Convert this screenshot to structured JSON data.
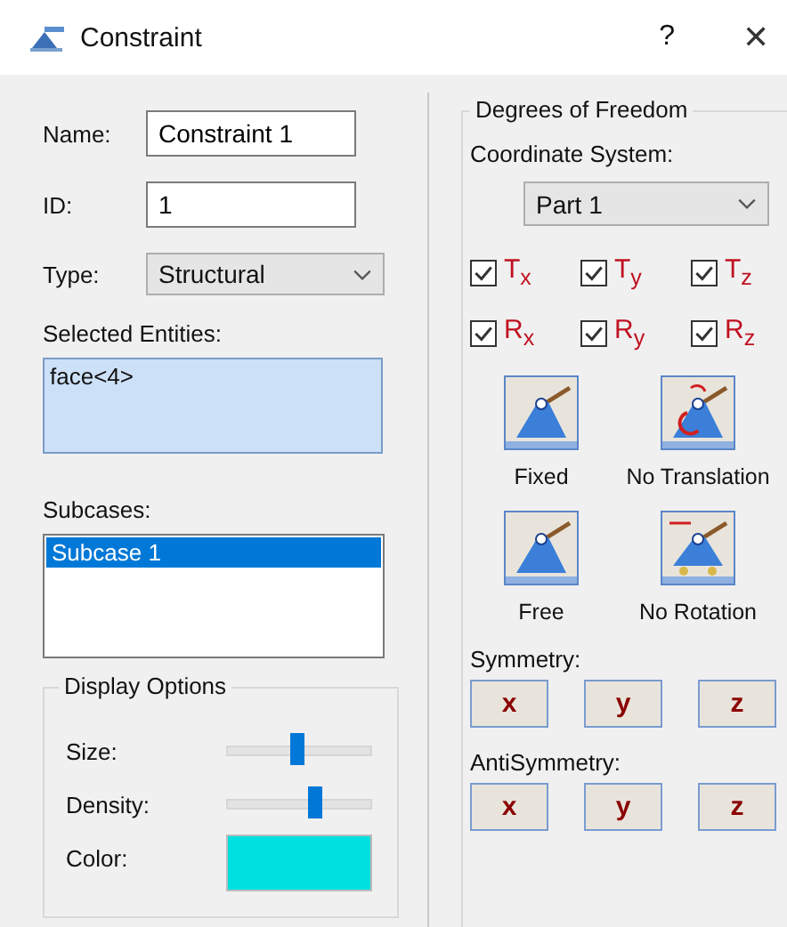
{
  "window": {
    "title": "Constraint",
    "help": "?",
    "close": "✕"
  },
  "name": {
    "label": "Name:",
    "value": "Constraint 1"
  },
  "id": {
    "label": "ID:",
    "value": "1"
  },
  "type": {
    "label": "Type:",
    "value": "Structural"
  },
  "selected_entities": {
    "label": "Selected Entities:",
    "items": [
      "face<4>"
    ]
  },
  "subcases": {
    "label": "Subcases:",
    "items": [
      {
        "label": "Subcase 1",
        "selected": true
      }
    ]
  },
  "display_options": {
    "title": "Display Options",
    "sliders": [
      {
        "label": "Size:",
        "level": 0.49
      },
      {
        "label": "Density:",
        "level": 0.61
      }
    ],
    "color": {
      "label": "Color:",
      "color": "#00e0e0"
    }
  },
  "dof": {
    "title": "Degrees of Freedom",
    "coordinate_label": "Coordinate System:",
    "coordinate_value": "Part 1",
    "checks": [
      {
        "label": "T$_{x}$",
        "checked": true
      },
      {
        "label": "T$_{y}$",
        "checked": true
      },
      {
        "label": "T$_{z}$",
        "checked": true
      },
      {
        "label": "R$_{x}$",
        "checked": true
      },
      {
        "label": "R$_{y}$",
        "checked": true
      },
      {
        "label": "R$_{z}$",
        "checked": true
      }
    ],
    "presets": [
      {
        "label": "Fixed",
        "kind": "fixed"
      },
      {
        "label": "No Translation",
        "kind": "notranslation"
      },
      {
        "label": "Free",
        "kind": "free"
      },
      {
        "label": "No Rotation",
        "kind": "norotation"
      }
    ],
    "symmetry": {
      "label": "Symmetry:",
      "buttons": [
        "x",
        "y",
        "z"
      ]
    },
    "antisymmetry": {
      "label": "AntiSymmetry:",
      "buttons": [
        "x",
        "y",
        "z"
      ]
    }
  }
}
